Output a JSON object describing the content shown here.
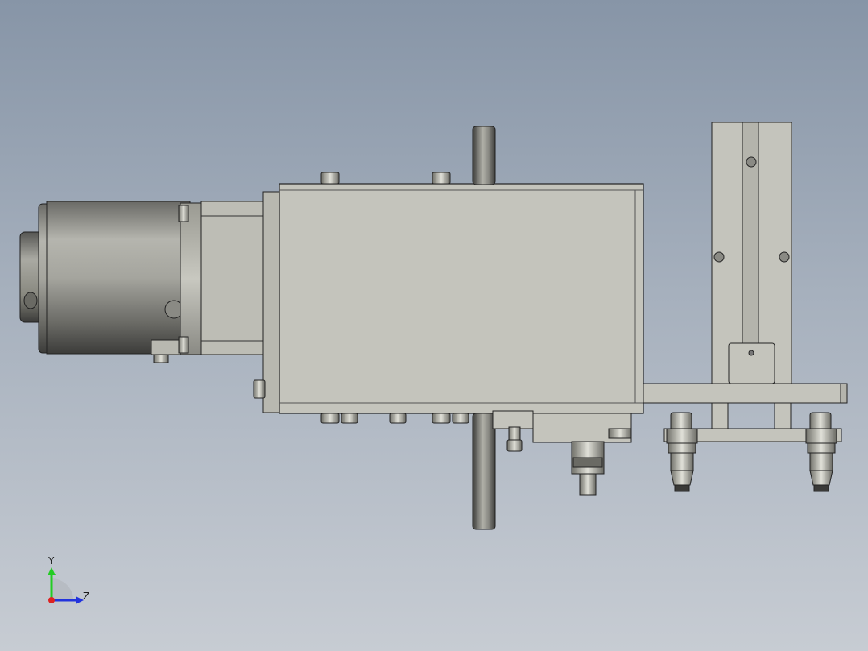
{
  "viewport": {
    "background_top": "#8795a7",
    "background_bottom": "#c7ccd3"
  },
  "triad": {
    "y_label": "Y",
    "z_label": "Z",
    "y_color": "#22cc22",
    "z_color": "#2233dd",
    "x_color": "#dd2222"
  },
  "model": {
    "body_color": "#c4c4bc",
    "metal_color": "#9a9a94",
    "dark_metal": "#4a4a48",
    "edge_color": "#2a2a2a"
  }
}
